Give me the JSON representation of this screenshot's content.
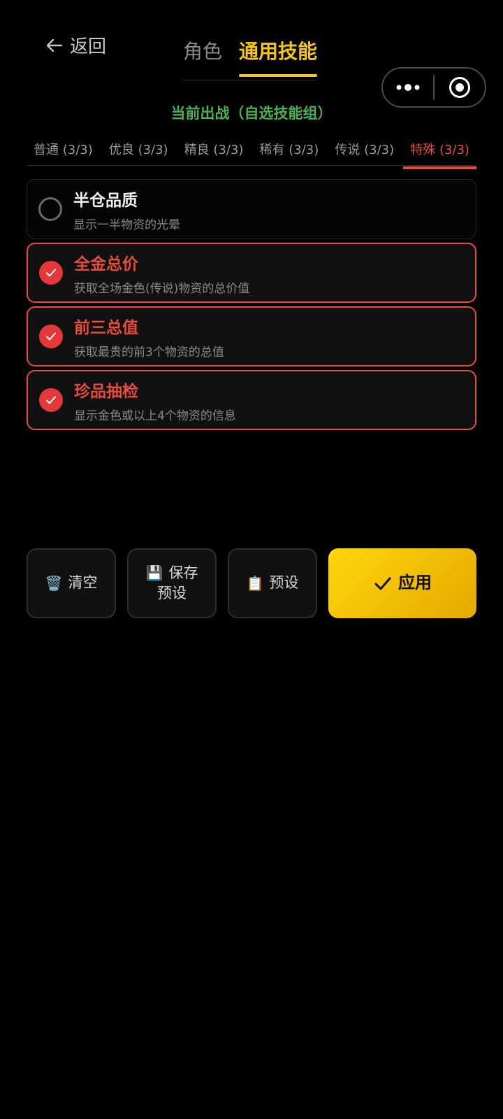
{
  "header": {
    "back_label": "返回",
    "tabs": [
      {
        "label": "角色",
        "active": false
      },
      {
        "label": "通用技能",
        "active": true
      }
    ]
  },
  "status": {
    "current": "当前出战（自选技能组）"
  },
  "categories": [
    {
      "label": "普通 (3/3)",
      "active": false
    },
    {
      "label": "优良 (3/3)",
      "active": false
    },
    {
      "label": "精良 (3/3)",
      "active": false
    },
    {
      "label": "稀有 (3/3)",
      "active": false
    },
    {
      "label": "传说 (3/3)",
      "active": false
    },
    {
      "label": "特殊 (3/3)",
      "active": true
    }
  ],
  "skills": [
    {
      "name": "半仓品质",
      "desc": "显示一半物资的光晕",
      "selected": false
    },
    {
      "name": "全金总价",
      "desc": "获取全场金色(传说)物资的总价值",
      "selected": true
    },
    {
      "name": "前三总值",
      "desc": "获取最贵的前3个物资的总值",
      "selected": true
    },
    {
      "name": "珍品抽检",
      "desc": "显示金色或以上4个物资的信息",
      "selected": true
    }
  ],
  "actions": {
    "clear_label": "清空",
    "clear_icon": "🗑️",
    "save_line1": "保存",
    "save_line2": "预设",
    "save_icon": "💾",
    "preset_label": "预设",
    "preset_icon": "📋",
    "apply_label": "应用"
  },
  "colors": {
    "accent_yellow": "#f5c518",
    "accent_red": "#e74c3c",
    "status_green": "#4caf50"
  }
}
